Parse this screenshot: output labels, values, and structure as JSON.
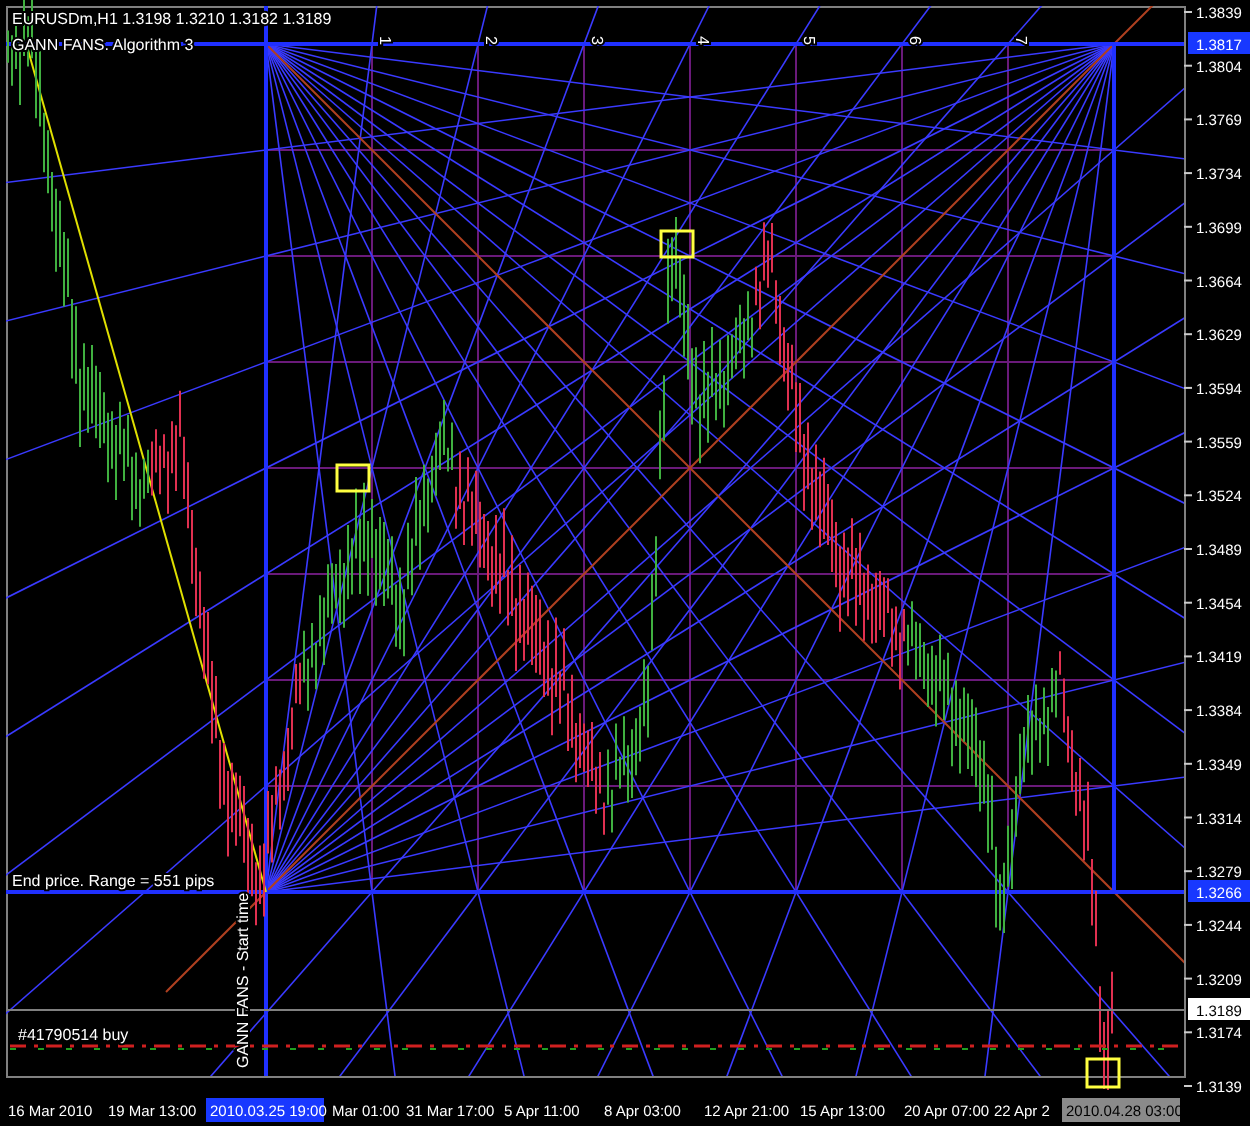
{
  "symbol_line": "EURUSDm,H1  1.3198 1.3210 1.3182 1.3189",
  "indicator_label": "GANN FANS. Algorithm 3",
  "gann_columns": [
    "1",
    "2",
    "3",
    "4",
    "5",
    "6",
    "7"
  ],
  "end_price_label": "End price. Range = 551 pips",
  "start_time_label": "GANN FANS - Start time",
  "order_label": "#41790514 buy",
  "price_axis": {
    "labels": [
      "1.3839",
      "1.3804",
      "1.3769",
      "1.3734",
      "1.3699",
      "1.3664",
      "1.3629",
      "1.3594",
      "1.3559",
      "1.3524",
      "1.3489",
      "1.3454",
      "1.3419",
      "1.3384",
      "1.3349",
      "1.3314",
      "1.3279",
      "1.3244",
      "1.3209",
      "1.3174",
      "1.3139"
    ],
    "markers": [
      {
        "text": "1.3817",
        "kind": "line"
      },
      {
        "text": "1.3266",
        "kind": "line"
      },
      {
        "text": "1.3189",
        "kind": "bid"
      }
    ]
  },
  "time_axis": {
    "labels": [
      "16 Mar 2010",
      "19 Mar 13:00",
      "Mar 01:00",
      "31 Mar 17:00",
      "5 Apr 11:00",
      "8 Apr 03:00",
      "12 Apr 21:00",
      "15 Apr 13:00",
      "20 Apr 07:00",
      "22 Apr 2"
    ],
    "markers": [
      {
        "text": "2010.03.25 19:00",
        "kind": "line"
      },
      {
        "text": "2010.04.28 03:00",
        "kind": "cursor"
      }
    ]
  }
}
